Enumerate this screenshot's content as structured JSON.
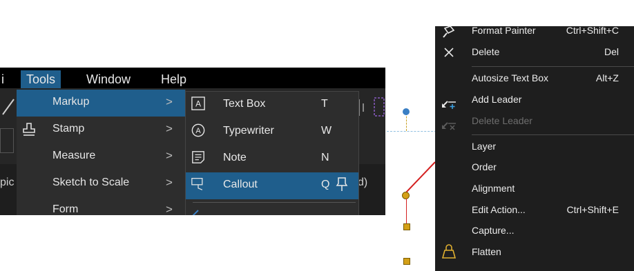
{
  "menubar": {
    "items": [
      {
        "label": "Tools"
      },
      {
        "label": "Window"
      },
      {
        "label": "Help"
      }
    ]
  },
  "background_text": {
    "left_fragment": "pic",
    "right_fragment": "d)"
  },
  "tools_menu": {
    "items": [
      {
        "label": "Markup",
        "arrow": ">"
      },
      {
        "label": "Stamp",
        "arrow": ">"
      },
      {
        "label": "Measure",
        "arrow": ">"
      },
      {
        "label": "Sketch to Scale",
        "arrow": ">"
      },
      {
        "label": "Form",
        "arrow": ">"
      }
    ]
  },
  "markup_menu": {
    "items": [
      {
        "label": "Text Box",
        "shortcut": "T",
        "icon": "text-box-icon"
      },
      {
        "label": "Typewriter",
        "shortcut": "W",
        "icon": "typewriter-icon"
      },
      {
        "label": "Note",
        "shortcut": "N",
        "icon": "note-icon"
      },
      {
        "label": "Callout",
        "shortcut": "Q",
        "icon": "callout-icon"
      }
    ]
  },
  "context_menu": {
    "items": [
      {
        "label": "Format Painter",
        "shortcut": "Ctrl+Shift+C",
        "icon": "format-painter-icon"
      },
      {
        "label": "Delete",
        "shortcut": "Del",
        "icon": "close-icon"
      },
      {
        "label": "Autosize Text Box",
        "shortcut": "Alt+Z"
      },
      {
        "label": "Add Leader",
        "icon": "add-leader-icon"
      },
      {
        "label": "Delete Leader",
        "icon": "delete-leader-icon",
        "disabled": true
      },
      {
        "label": "Layer"
      },
      {
        "label": "Order"
      },
      {
        "label": "Alignment"
      },
      {
        "label": "Edit Action...",
        "shortcut": "Ctrl+Shift+E"
      },
      {
        "label": "Capture..."
      },
      {
        "label": "Flatten",
        "icon": "flatten-icon"
      }
    ]
  },
  "colors": {
    "highlight": "#1f5e8c",
    "menu_bg": "#2d2d2d",
    "context_bg": "#1e1e1e",
    "leader_line": "#d42020",
    "handle_yellow": "#d4a017",
    "handle_blue": "#3a7fc4",
    "flatten_icon": "#e0b030"
  }
}
